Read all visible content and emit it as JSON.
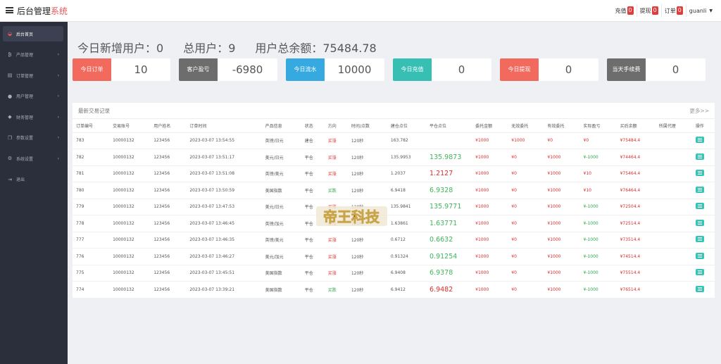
{
  "header": {
    "brand_main": "后台管理",
    "brand_accent": "系统",
    "nav": [
      {
        "label": "充值",
        "count": "0"
      },
      {
        "label": "提现",
        "count": "0"
      },
      {
        "label": "订单",
        "count": "0"
      }
    ],
    "user": "guanli"
  },
  "sidebar": {
    "items": [
      {
        "label": "后台首页",
        "icon": "dashboard-icon",
        "active": true
      },
      {
        "label": "产品管理",
        "icon": "bitcoin-icon"
      },
      {
        "label": "订单管理",
        "icon": "order-icon"
      },
      {
        "label": "用户管理",
        "icon": "user-icon"
      },
      {
        "label": "财务管理",
        "icon": "finance-icon"
      },
      {
        "label": "参数设置",
        "icon": "copy-icon"
      },
      {
        "label": "系统设置",
        "icon": "gears-icon"
      },
      {
        "label": "退出",
        "icon": "logout-icon"
      }
    ]
  },
  "summary": {
    "new_users": "今日新增用户：0",
    "total_users": "总用户：9",
    "balance": "用户总余额：75484.78"
  },
  "cards": [
    {
      "label": "今日订单",
      "value": "10",
      "color": "#f26a5e"
    },
    {
      "label": "客户盈亏",
      "value": "-6980",
      "color": "#6d6d6d"
    },
    {
      "label": "今日流水",
      "value": "10000",
      "color": "#36a9e1"
    },
    {
      "label": "今日充值",
      "value": "0",
      "color": "#37bfb4"
    },
    {
      "label": "今日提现",
      "value": "0",
      "color": "#f26a5e"
    },
    {
      "label": "当天手续费",
      "value": "0",
      "color": "#6d6d6d"
    }
  ],
  "panel": {
    "title": "最新交易记录",
    "more": "更多>>"
  },
  "table": {
    "headers": [
      "订单编号",
      "交易账号",
      "用户姓名",
      "订单时间",
      "产品信息",
      "状态",
      "方向",
      "时间/点数",
      "建仓点位",
      "平仓点位",
      "委托金额",
      "无效委托",
      "有效委托",
      "实际盈亏",
      "买后余额",
      "所属代理",
      "操作"
    ],
    "rows": [
      {
        "id": "783",
        "acct": "10000132",
        "name": "123456",
        "time": "2023-03-07 13:54:55",
        "product": "英镑/日元",
        "status": "建仓",
        "dir": "买涨",
        "dur": "120秒",
        "open": "163.782",
        "close": "",
        "amt": "¥1000",
        "invalid": "¥1000",
        "valid": "¥0",
        "pnl": "¥0",
        "after": "¥75484.4",
        "close_class": ""
      },
      {
        "id": "782",
        "acct": "10000132",
        "name": "123456",
        "time": "2023-03-07 13:51:17",
        "product": "美元/日元",
        "status": "平仓",
        "dir": "买涨",
        "dur": "120秒",
        "open": "135.9953",
        "close": "135.9873",
        "amt": "¥1000",
        "invalid": "¥0",
        "valid": "¥1000",
        "pnl": "¥-1000",
        "after": "¥74464.4",
        "close_class": "bigg"
      },
      {
        "id": "781",
        "acct": "10000132",
        "name": "123456",
        "time": "2023-03-07 13:51:08",
        "product": "英镑/美元",
        "status": "平仓",
        "dir": "买涨",
        "dur": "120秒",
        "open": "1.2037",
        "close": "1.2127",
        "amt": "¥1000",
        "invalid": "¥0",
        "valid": "¥1000",
        "pnl": "¥10",
        "after": "¥75464.4",
        "close_class": "bigr"
      },
      {
        "id": "780",
        "acct": "10000132",
        "name": "123456",
        "time": "2023-03-07 13:50:59",
        "product": "美国指数",
        "status": "平仓",
        "dir": "买跌",
        "dur": "120秒",
        "open": "6.9418",
        "close": "6.9328",
        "amt": "¥1000",
        "invalid": "¥0",
        "valid": "¥1000",
        "pnl": "¥10",
        "after": "¥76464.4",
        "close_class": "bigg"
      },
      {
        "id": "779",
        "acct": "10000132",
        "name": "123456",
        "time": "2023-03-07 13:47:53",
        "product": "美元/日元",
        "status": "平仓",
        "dir": "买涨",
        "dur": "120秒",
        "open": "135.9841",
        "close": "135.9771",
        "amt": "¥1000",
        "invalid": "¥0",
        "valid": "¥1000",
        "pnl": "¥-1000",
        "after": "¥72504.4",
        "close_class": "bigg"
      },
      {
        "id": "778",
        "acct": "10000132",
        "name": "123456",
        "time": "2023-03-07 13:46:45",
        "product": "英镑/加元",
        "status": "平仓",
        "dir": "买涨",
        "dur": "120秒",
        "open": "1.63861",
        "close": "1.63771",
        "amt": "¥1000",
        "invalid": "¥0",
        "valid": "¥1000",
        "pnl": "¥-1000",
        "after": "¥72514.4",
        "close_class": "bigg"
      },
      {
        "id": "777",
        "acct": "10000132",
        "name": "123456",
        "time": "2023-03-07 13:46:35",
        "product": "英镑/美元",
        "status": "平仓",
        "dir": "买涨",
        "dur": "120秒",
        "open": "0.6712",
        "close": "0.6632",
        "amt": "¥1000",
        "invalid": "¥0",
        "valid": "¥1000",
        "pnl": "¥-1000",
        "after": "¥73514.4",
        "close_class": "bigg"
      },
      {
        "id": "776",
        "acct": "10000132",
        "name": "123456",
        "time": "2023-03-07 13:46:27",
        "product": "美元/加元",
        "status": "平仓",
        "dir": "买涨",
        "dur": "120秒",
        "open": "0.91324",
        "close": "0.91254",
        "amt": "¥1000",
        "invalid": "¥0",
        "valid": "¥1000",
        "pnl": "¥-1000",
        "after": "¥74514.4",
        "close_class": "bigg"
      },
      {
        "id": "775",
        "acct": "10000132",
        "name": "123456",
        "time": "2023-03-07 13:45:51",
        "product": "美国指数",
        "status": "平仓",
        "dir": "买涨",
        "dur": "120秒",
        "open": "6.9408",
        "close": "6.9378",
        "amt": "¥1000",
        "invalid": "¥0",
        "valid": "¥1000",
        "pnl": "¥-1000",
        "after": "¥75514.4",
        "close_class": "bigg"
      },
      {
        "id": "774",
        "acct": "10000132",
        "name": "123456",
        "time": "2023-03-07 13:39:21",
        "product": "美国指数",
        "status": "平仓",
        "dir": "买跌",
        "dur": "120秒",
        "open": "6.9412",
        "close": "6.9482",
        "amt": "¥1000",
        "invalid": "¥0",
        "valid": "¥1000",
        "pnl": "¥-1000",
        "after": "¥76514.4",
        "close_class": "bigr"
      }
    ]
  },
  "watermark": {
    "text": "帝王科技",
    "icon": "brand-logo"
  }
}
